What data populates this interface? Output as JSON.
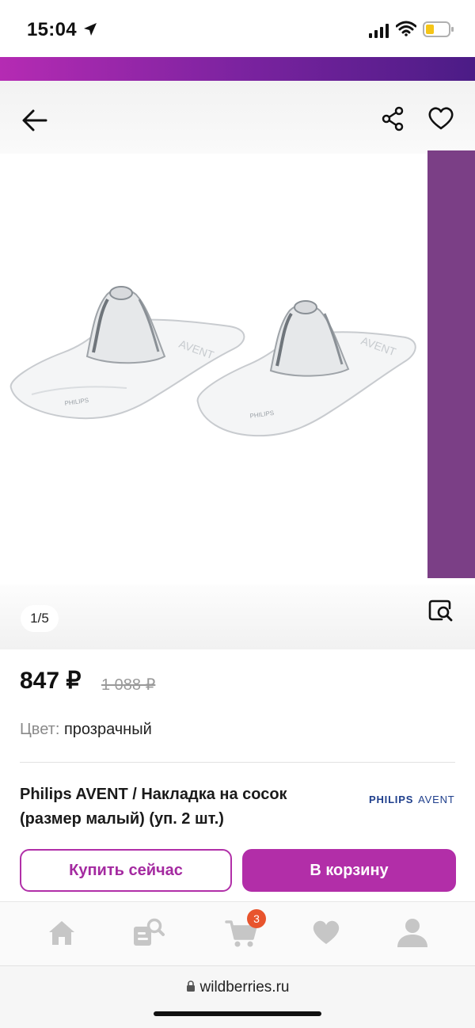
{
  "status_bar": {
    "time": "15:04"
  },
  "header": {},
  "gallery": {
    "counter": "1/5"
  },
  "product": {
    "price": "847 ₽",
    "old_price": "1 088 ₽",
    "color_label": "Цвет:",
    "color_value": "прозрачный",
    "title": "Philips AVENT / Накладка на сосок (размер малый) (уп. 2 шт.)",
    "brand_logo_1": "PHILIPS",
    "brand_logo_2": "AVENT"
  },
  "actions": {
    "buy_now": "Купить сейчас",
    "add_to_cart": "В корзину"
  },
  "nav": {
    "cart_count": "3",
    "items": [
      "home-icon",
      "catalog-search-icon",
      "cart-icon",
      "heart-icon",
      "profile-icon"
    ]
  },
  "browser": {
    "url": "wildberries.ru"
  },
  "colors": {
    "accent": "#b22ea8",
    "strip_start": "#b52bb3",
    "strip_end": "#4b1c86",
    "badge": "#e8542d"
  }
}
